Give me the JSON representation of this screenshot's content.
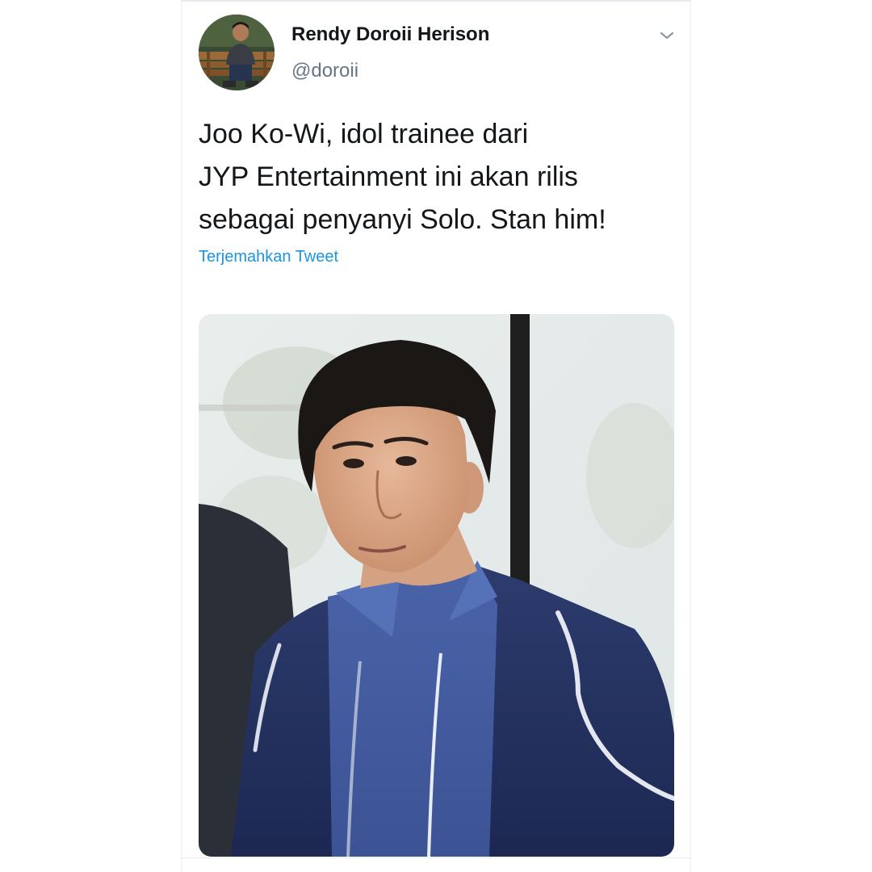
{
  "user": {
    "display_name": "Rendy Doroii Herison",
    "handle": "@doroii"
  },
  "tweet": {
    "lines": [
      "Joo Ko-Wi, idol trainee dari",
      "JYP Entertainment ini akan rilis",
      "sebagai penyanyi Solo. Stan him!"
    ],
    "translate_label": "Terjemahkan Tweet"
  },
  "icons": {
    "menu": "chevron-down-icon"
  },
  "colors": {
    "link": "#1b95e0",
    "secondary_text": "#657786",
    "primary_text": "#14171a"
  }
}
